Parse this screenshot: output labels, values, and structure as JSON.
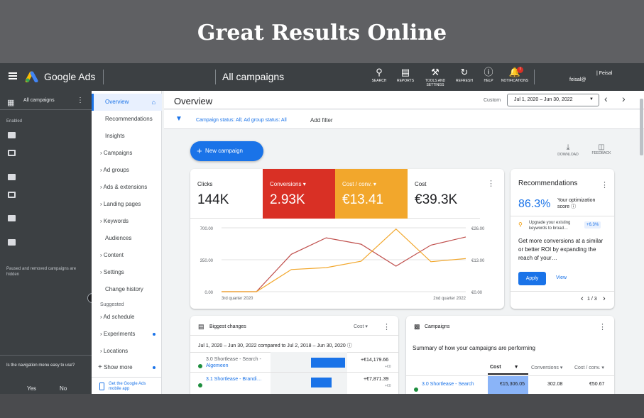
{
  "banner": {
    "title": "Great Results Online"
  },
  "topbar": {
    "menu_icon": "hamburger-icon",
    "product": "Google Ads",
    "page": "All campaigns",
    "tools": [
      {
        "label": "SEARCH",
        "icon": "search-icon"
      },
      {
        "label": "REPORTS",
        "icon": "reports-icon"
      },
      {
        "label": "TOOLS AND SETTINGS",
        "icon": "wrench-icon"
      },
      {
        "label": "REFRESH",
        "icon": "refresh-icon"
      },
      {
        "label": "HELP",
        "icon": "help-icon"
      },
      {
        "label": "NOTIFICATIONS",
        "icon": "bell-icon",
        "badge": "!"
      }
    ],
    "account_name": "| Feisal",
    "account_email": "feisal@"
  },
  "left_rail": {
    "all_campaigns": "All campaigns",
    "enabled_label": "Enabled",
    "paused_note": "Paused and removed campaigns are hidden",
    "feedback_question": "Is the navigation menu easy to use?",
    "yes": "Yes",
    "no": "No"
  },
  "nav": {
    "items": [
      "Overview",
      "Recommendations",
      "Insights",
      "Campaigns",
      "Ad groups",
      "Ads & extensions",
      "Landing pages",
      "Keywords",
      "Audiences",
      "Content",
      "Settings",
      "Change history"
    ],
    "suggested_label": "Suggested",
    "suggested_items": [
      "Ad schedule",
      "Experiments",
      "Locations"
    ],
    "show_more": "Show more",
    "mobile_app": "Get the Google Ads mobile app"
  },
  "header": {
    "title": "Overview",
    "custom": "Custom",
    "date_range": "Jul 1, 2020 – Jun 30, 2022"
  },
  "filter": {
    "text": "Campaign status: All; Ad group status: All",
    "add": "Add filter"
  },
  "actions": {
    "new_campaign": "New campaign",
    "download": "DOWNLOAD",
    "feedback": "FEEDBACK"
  },
  "metrics": [
    {
      "label": "Clicks",
      "value": "144K",
      "color": "#ffffff"
    },
    {
      "label": "Conversions",
      "value": "2.93K",
      "color": "#d93025"
    },
    {
      "label": "Cost / conv.",
      "value": "€13.41",
      "color": "#f2a72c"
    },
    {
      "label": "Cost",
      "value": "€39.3K",
      "color": "#ffffff"
    }
  ],
  "chart_data": {
    "type": "line",
    "x_labels": [
      "3rd quarter 2020",
      "2nd quarter 2022"
    ],
    "left_axis": [
      "700.00",
      "350.00",
      "0.00"
    ],
    "right_axis": [
      "€26.00",
      "€13.00",
      "€0.00"
    ],
    "ylim_left": [
      0,
      700
    ],
    "ylim_right": [
      0,
      26
    ],
    "series": [
      {
        "name": "Conversions",
        "color": "#c0504d",
        "axis": "left",
        "values": [
          0,
          0,
          410,
          590,
          520,
          280,
          510,
          600
        ]
      },
      {
        "name": "Cost / conv.",
        "color": "#f2a72c",
        "axis": "right",
        "values": [
          0,
          0,
          9,
          9.8,
          12.4,
          25.5,
          12.2,
          13.5
        ]
      }
    ]
  },
  "recommendations": {
    "title": "Recommendations",
    "score": "86.3%",
    "score_label": "Your optimization score",
    "tip": "Upgrade your existing keywords to broad…",
    "tip_delta": "+6.3%",
    "body": "Get more conversions at a similar or better ROI by expanding the reach of your…",
    "apply": "Apply",
    "view": "View",
    "pager": "1 / 3"
  },
  "changes": {
    "title": "Biggest changes",
    "sort": "Cost",
    "compare": "Jul 1, 2020 – Jun 30, 2022 compared to Jul 2, 2018 – Jun 30, 2020",
    "rows": [
      {
        "name": "3.0 Shortlease - Search -",
        "sub": "Algemeen",
        "value": "+€14,179.66",
        "sub_value": "+€0",
        "bar": 0.9
      },
      {
        "name": "3.1 Shortlease - Brandi…",
        "sub": "",
        "value": "+€7,871.39",
        "sub_value": "+€0",
        "bar": 0.55
      }
    ]
  },
  "campaigns": {
    "title": "Campaigns",
    "summary": "Summary of how your campaigns are performing",
    "cols": [
      "Cost",
      "Conversions",
      "Cost / conv."
    ],
    "rows": [
      {
        "name": "3.0 Shortlease - Search",
        "cost": "€15,306.05",
        "conv": "302.08",
        "cpc": "€50.67"
      }
    ]
  }
}
